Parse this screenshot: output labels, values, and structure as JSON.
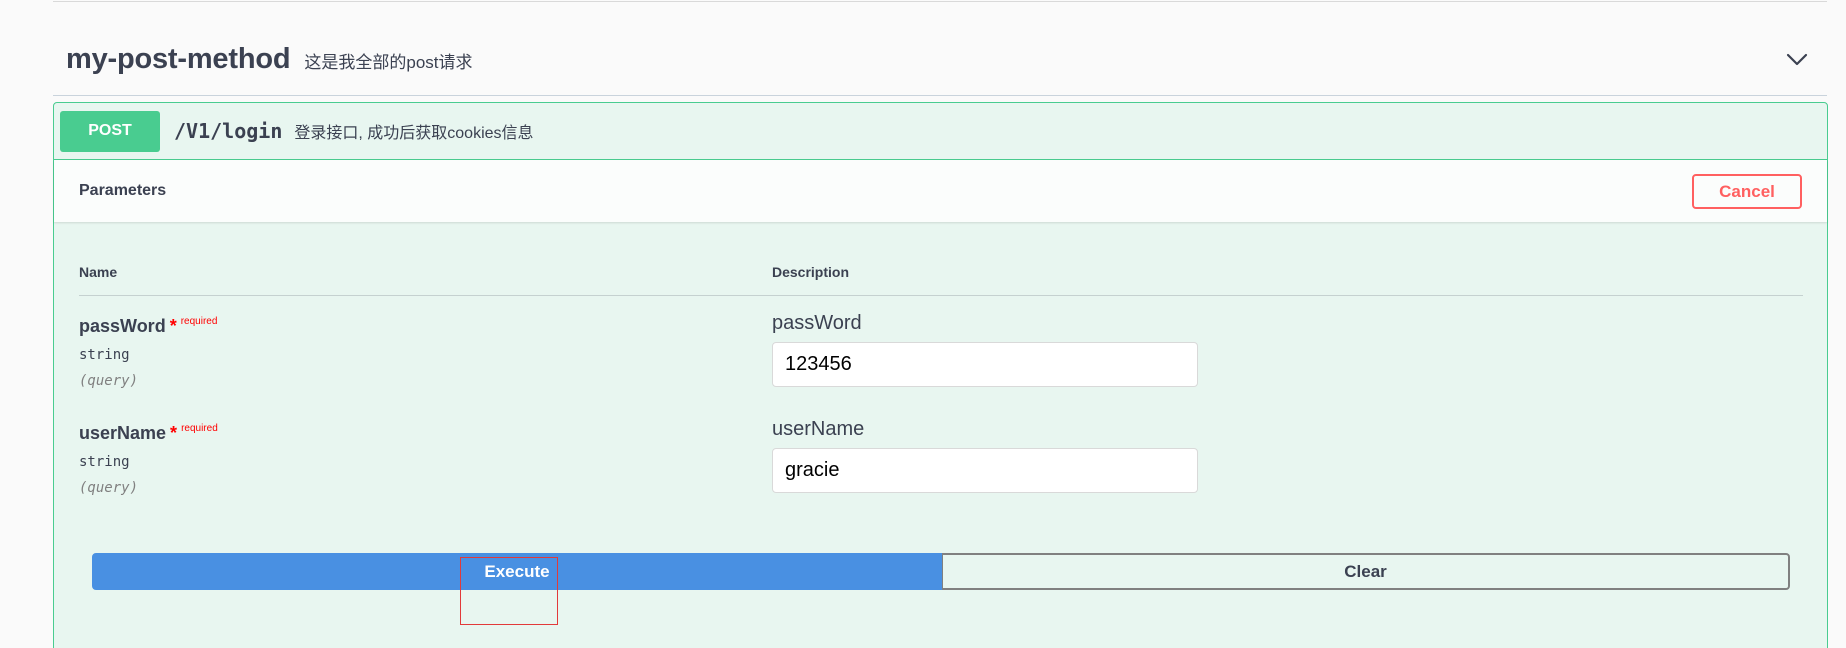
{
  "tag": {
    "name": "my-post-method",
    "description": "这是我全部的post请求",
    "expand_icon": "chevron-down-icon"
  },
  "operation": {
    "method": "POST",
    "path": "/V1/login",
    "summary": "登录接口, 成功后获取cookies信息"
  },
  "parameters_section": {
    "title": "Parameters",
    "cancel_label": "Cancel"
  },
  "table": {
    "name_header": "Name",
    "description_header": "Description"
  },
  "params": [
    {
      "name": "passWord",
      "required_star": "*",
      "required_label": "required",
      "type": "string",
      "in": "(query)",
      "label": "passWord",
      "value": "123456"
    },
    {
      "name": "userName",
      "required_star": "*",
      "required_label": "required",
      "type": "string",
      "in": "(query)",
      "label": "userName",
      "value": "gracie"
    }
  ],
  "actions": {
    "execute_label": "Execute",
    "clear_label": "Clear"
  },
  "colors": {
    "post_green": "#49cc90",
    "execute_blue": "#4990e2",
    "cancel_red": "#ff6060",
    "required_red": "#ff0000"
  }
}
